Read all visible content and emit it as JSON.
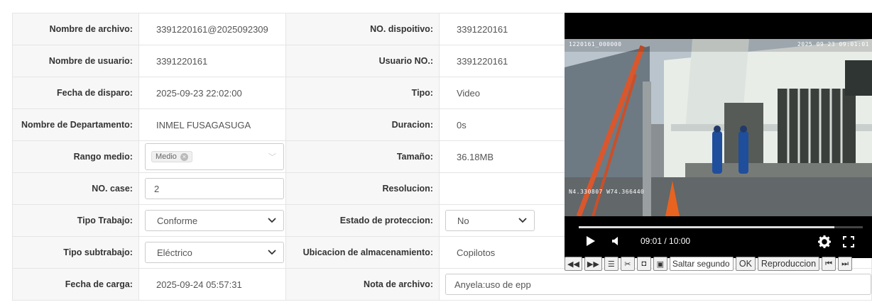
{
  "fields": {
    "nombre_archivo": {
      "label": "Nombre de archivo:",
      "value": "3391220161@2025092309"
    },
    "no_dispositivo": {
      "label": "NO. dispoitivo:",
      "value": "3391220161"
    },
    "nombre_usuario": {
      "label": "Nombre de usuario:",
      "value": "3391220161"
    },
    "usuario_no": {
      "label": "Usuario NO.:",
      "value": "3391220161"
    },
    "fecha_disparo": {
      "label": "Fecha de disparo:",
      "value": "2025-09-23 22:02:00"
    },
    "tipo": {
      "label": "Tipo:",
      "value": "Video"
    },
    "departamento": {
      "label": "Nombre de Departamento:",
      "value": "INMEL FUSAGASUGA"
    },
    "duracion": {
      "label": "Duracion:",
      "value": "0s"
    },
    "rango_medio": {
      "label": "Rango medio:",
      "tag": "Medio"
    },
    "tamano": {
      "label": "Tamaño:",
      "value": "36.18MB"
    },
    "no_case": {
      "label": "NO. case:",
      "value": "2"
    },
    "resolucion": {
      "label": "Resolucion:",
      "value": ""
    },
    "tipo_trabajo": {
      "label": "Tipo Trabajo:",
      "value": "Conforme"
    },
    "estado_proteccion": {
      "label": "Estado de proteccion:",
      "value": "No"
    },
    "tipo_subtrabajo": {
      "label": "Tipo subtrabajo:",
      "value": "Eléctrico"
    },
    "ubicacion": {
      "label": "Ubicacion de almacenamiento:",
      "value": "Copilotos"
    },
    "fecha_carga": {
      "label": "Fecha de carga:",
      "value": "2025-09-24 05:57:31"
    },
    "nota_archivo": {
      "label": "Nota de archivo:",
      "value": "Anyela:uso de epp"
    }
  },
  "video": {
    "osd_top_left": "1220161_000000",
    "osd_top_right": "2025 09 23 09:01:01",
    "osd_gps": "N4.330807 W74.366440",
    "time": "09:01 / 10:00",
    "progress": 0.9
  },
  "toolbar": {
    "seek_placeholder": "Saltar segundo",
    "ok_label": "OK",
    "play_label": "Reproduccion"
  },
  "icons": {
    "play": "play-icon",
    "volume": "volume-icon",
    "settings": "gear-icon",
    "fullscreen": "fullscreen-icon"
  }
}
